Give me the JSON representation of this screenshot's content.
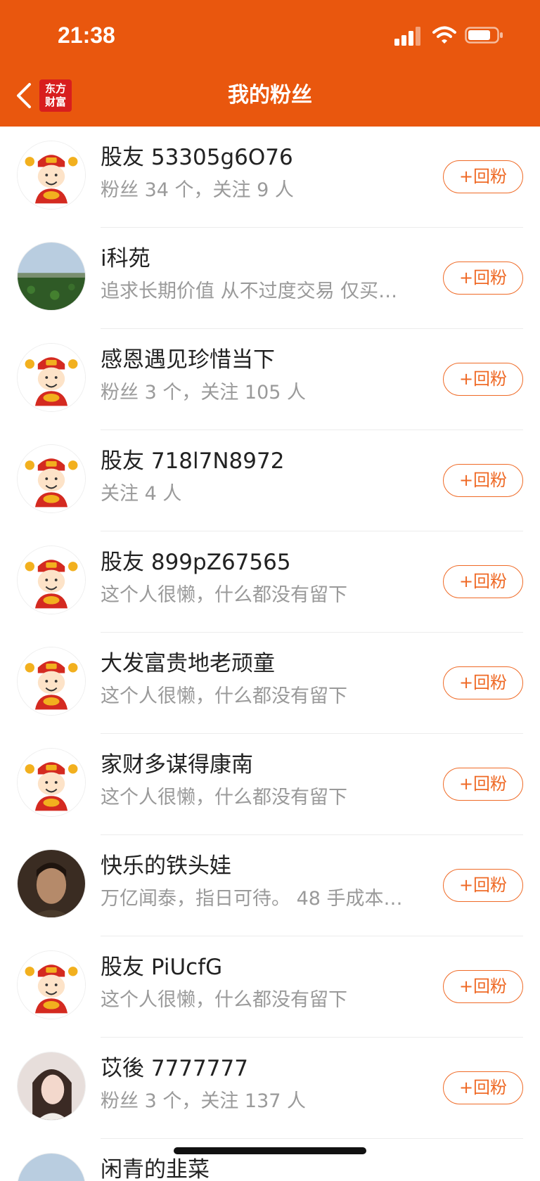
{
  "status_bar": {
    "time": "21:38"
  },
  "header": {
    "title": "我的粉丝",
    "logo_line1": "东方",
    "logo_line2": "财富"
  },
  "theme": {
    "accent": "#e9570e",
    "button": "#ef6a26"
  },
  "fans": [
    {
      "name": "股友 53305g6O76",
      "sub": "粉丝 34 个，关注 9 人",
      "button": "+回粉",
      "avatar": "caishen"
    },
    {
      "name": "i科苑",
      "sub": "追求长期价值 从不过度交易 仅买…",
      "button": "+回粉",
      "avatar": "landscape"
    },
    {
      "name": "感恩遇见珍惜当下",
      "sub": "粉丝 3 个，关注 105 人",
      "button": "+回粉",
      "avatar": "caishen"
    },
    {
      "name": "股友 718l7N8972",
      "sub": "关注 4 人",
      "button": "+回粉",
      "avatar": "caishen"
    },
    {
      "name": "股友 899pZ67565",
      "sub": "这个人很懒，什么都没有留下",
      "button": "+回粉",
      "avatar": "caishen"
    },
    {
      "name": "大发富贵地老顽童",
      "sub": "这个人很懒，什么都没有留下",
      "button": "+回粉",
      "avatar": "caishen"
    },
    {
      "name": "家财多谋得康南",
      "sub": "这个人很懒，什么都没有留下",
      "button": "+回粉",
      "avatar": "caishen"
    },
    {
      "name": "快乐的铁头娃",
      "sub": "万亿闻泰，指日可待。 48 手成本…",
      "button": "+回粉",
      "avatar": "man-photo"
    },
    {
      "name": "股友 PiUcfG",
      "sub": "这个人很懒，什么都没有留下",
      "button": "+回粉",
      "avatar": "caishen"
    },
    {
      "name": "苡後 7777777",
      "sub": "粉丝 3 个，关注 137 人",
      "button": "+回粉",
      "avatar": "woman-photo"
    },
    {
      "name": "闲青的韭菜",
      "sub": "",
      "button": "",
      "avatar": "landscape"
    }
  ]
}
